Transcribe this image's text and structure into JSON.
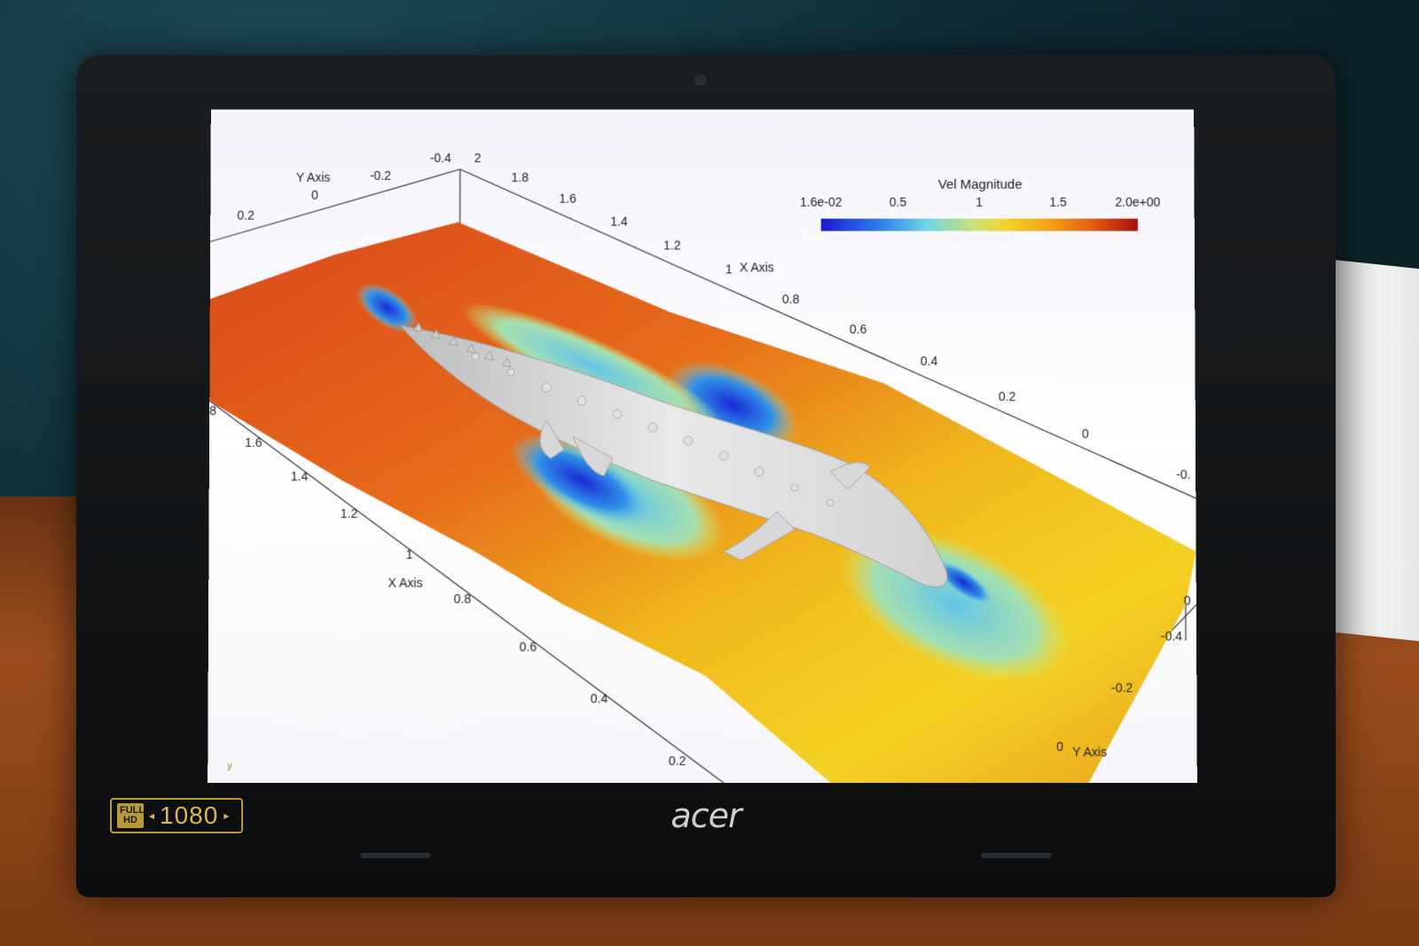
{
  "viewer": {
    "legend": {
      "title": "Vel Magnitude",
      "ticks": [
        "1.6e-02",
        "0.5",
        "1",
        "1.5",
        "2.0e+00"
      ],
      "colormap": [
        "#1b1bd0",
        "#2e7ae6",
        "#6fd3e8",
        "#c9e27a",
        "#f2d52a",
        "#f1a21a",
        "#e25a12",
        "#a81010"
      ]
    },
    "axes": {
      "x_axis_title": "X Axis",
      "y_axis_title": "Y Axis",
      "top_y_ticks": [
        "0.2",
        "0",
        "-0.2",
        "-0.4"
      ],
      "top_x_ticks": [
        "2",
        "1.8",
        "1.6",
        "1.4",
        "1.2",
        "1",
        "0.8",
        "0.6",
        "0.4",
        "0.2",
        "0",
        "-0."
      ],
      "left_x_ticks": [
        "8",
        "1.6",
        "1.4",
        "1.2",
        "1",
        "0.8",
        "0.6",
        "0.4",
        "0.2"
      ],
      "right_y_ticks": [
        "0",
        "-0.4",
        "-0.2",
        "0"
      ]
    },
    "corner_glyph": "y"
  },
  "laptop": {
    "badge_full": "FULL",
    "badge_hd": "HD",
    "badge_resolution": "1080",
    "brand": "acer"
  }
}
